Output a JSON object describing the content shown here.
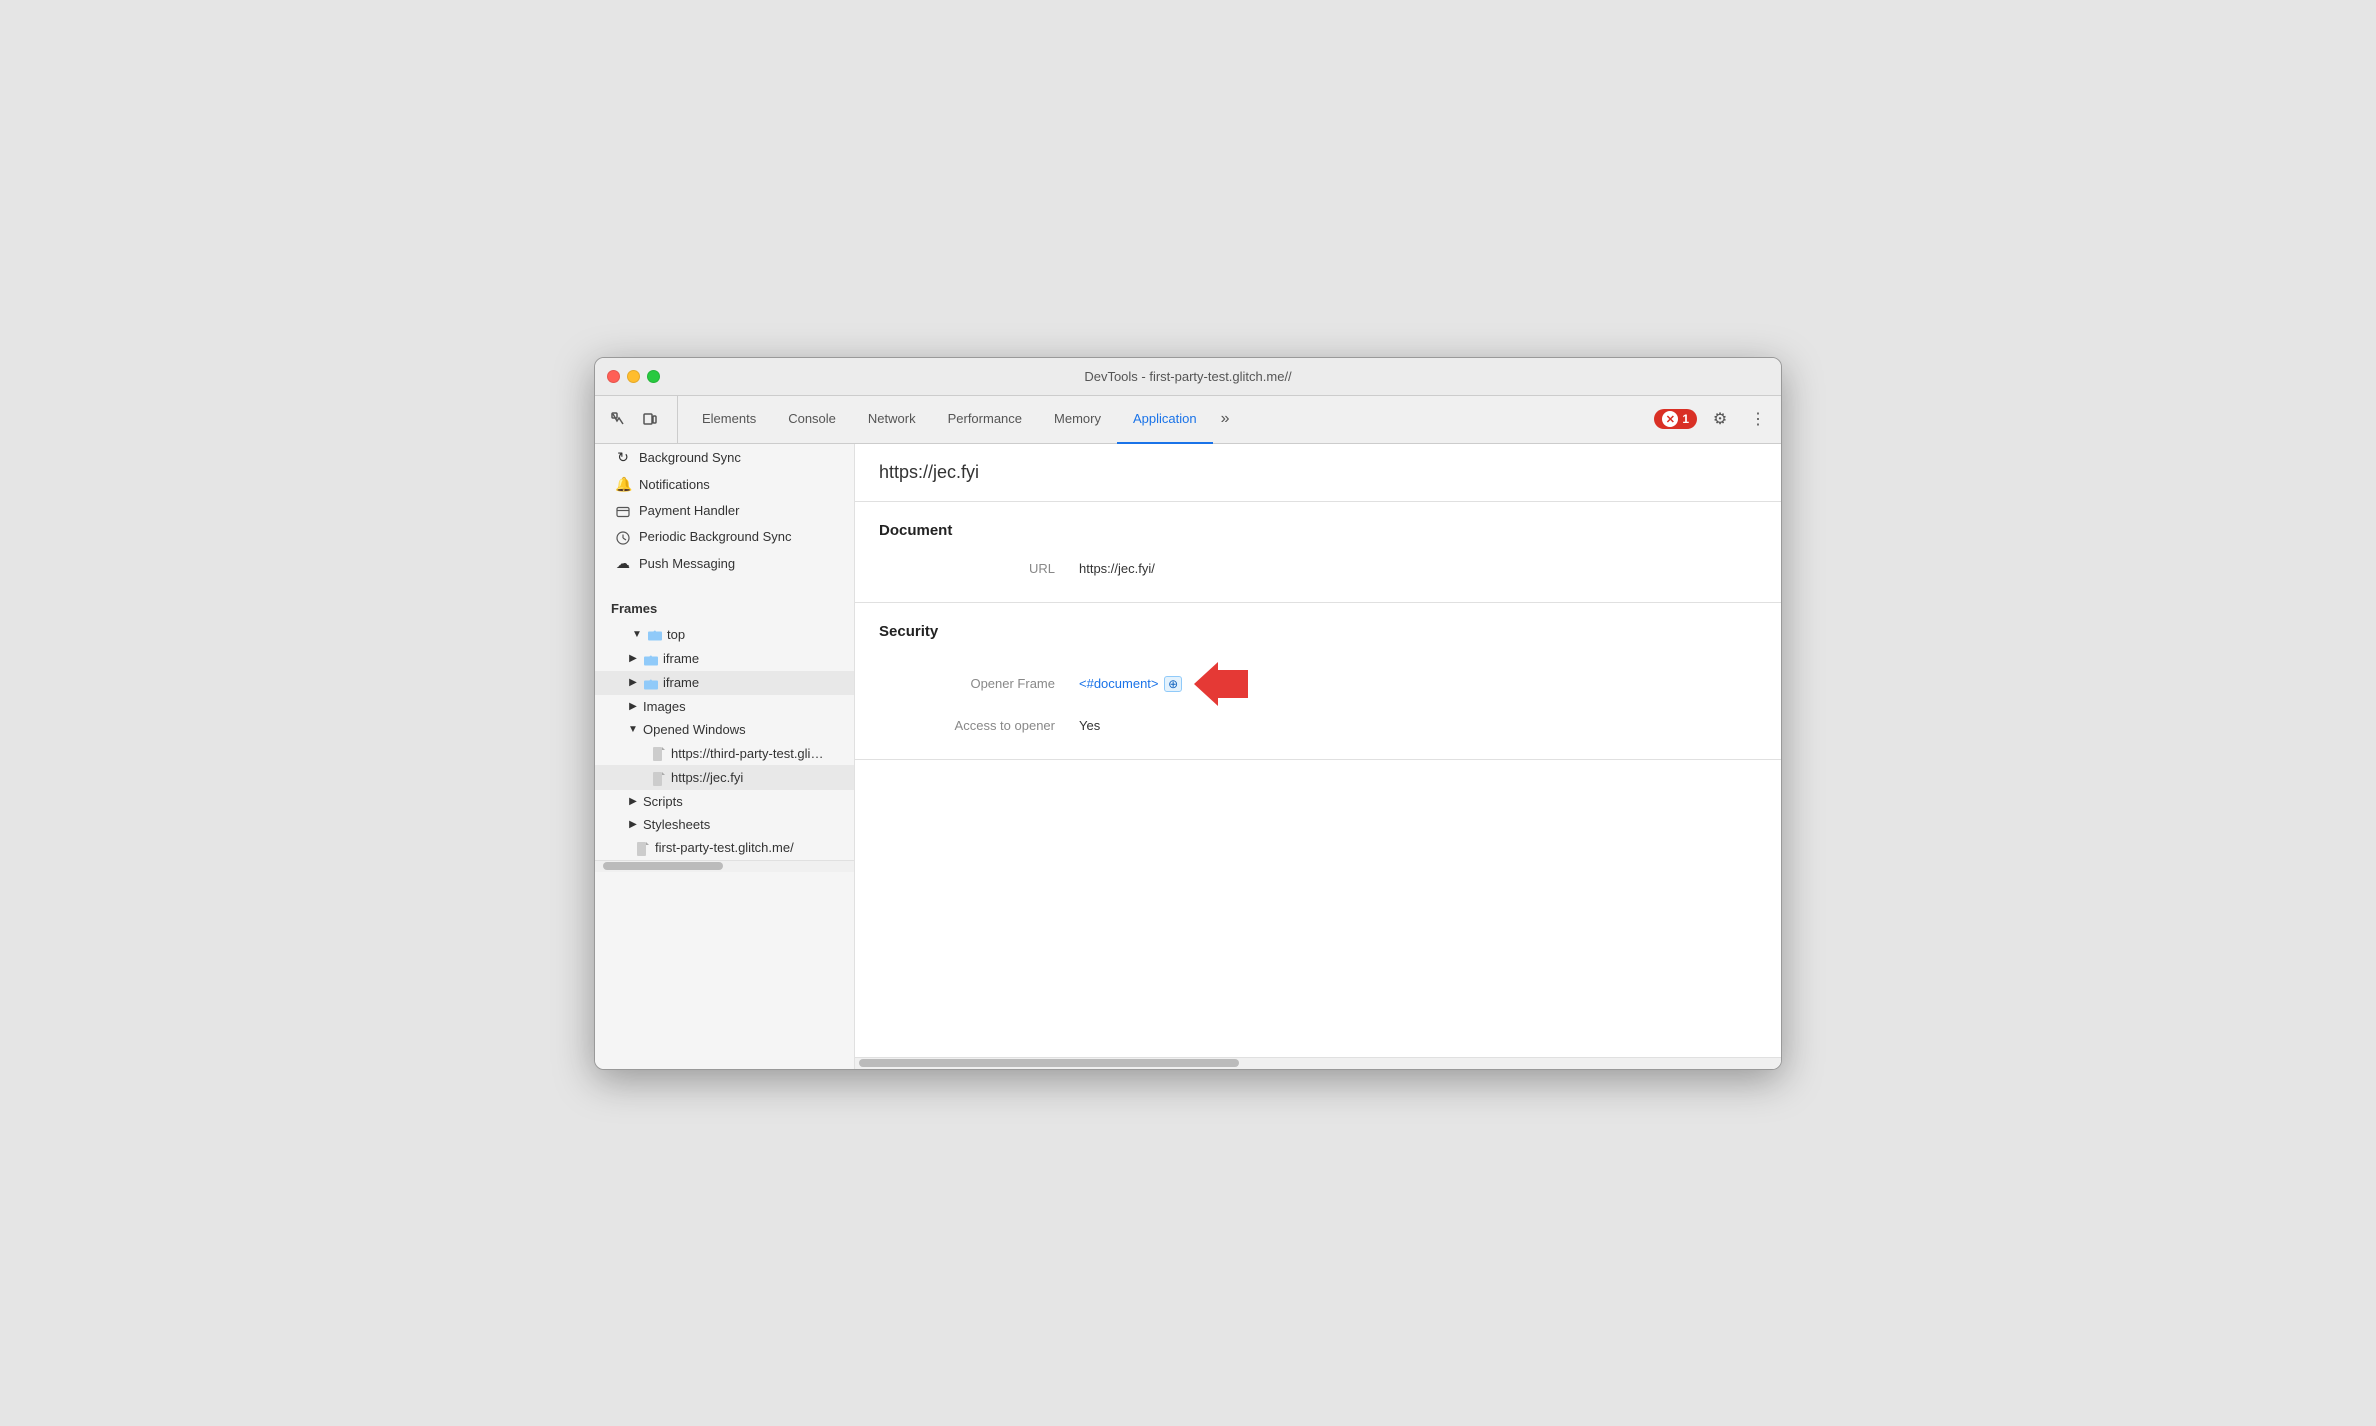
{
  "window": {
    "title": "DevTools - first-party-test.glitch.me//"
  },
  "toolbar": {
    "tabs": [
      {
        "label": "Elements",
        "active": false
      },
      {
        "label": "Console",
        "active": false
      },
      {
        "label": "Network",
        "active": false
      },
      {
        "label": "Performance",
        "active": false
      },
      {
        "label": "Memory",
        "active": false
      },
      {
        "label": "Application",
        "active": true
      }
    ],
    "more_label": "»",
    "error_count": "1",
    "settings_label": "⚙",
    "kebab_label": "⋮"
  },
  "sidebar": {
    "items_above": [
      {
        "label": "Background Sync",
        "icon": "sync",
        "indent": 0
      },
      {
        "label": "Notifications",
        "icon": "bell",
        "indent": 0
      },
      {
        "label": "Payment Handler",
        "icon": "credit-card",
        "indent": 0
      },
      {
        "label": "Periodic Background Sync",
        "icon": "clock",
        "indent": 0
      },
      {
        "label": "Push Messaging",
        "icon": "cloud",
        "indent": 0
      }
    ],
    "frames_section": "Frames",
    "tree": [
      {
        "label": "top",
        "type": "folder",
        "indent": 0,
        "expanded": true,
        "toggleable": true
      },
      {
        "label": "iframe",
        "type": "folder",
        "indent": 1,
        "expanded": false,
        "toggleable": true
      },
      {
        "label": "iframe",
        "type": "folder",
        "indent": 1,
        "expanded": false,
        "toggleable": true,
        "selected": true
      },
      {
        "label": "Images",
        "type": "folder-plain",
        "indent": 1,
        "expanded": false,
        "toggleable": true
      },
      {
        "label": "Opened Windows",
        "type": "folder-plain",
        "indent": 1,
        "expanded": true,
        "toggleable": true
      },
      {
        "label": "https://third-party-test.glitch.me/p",
        "type": "file",
        "indent": 2
      },
      {
        "label": "https://jec.fyi",
        "type": "file",
        "indent": 2,
        "selected": true
      },
      {
        "label": "Scripts",
        "type": "folder-plain",
        "indent": 1,
        "expanded": false,
        "toggleable": true
      },
      {
        "label": "Stylesheets",
        "type": "folder-plain",
        "indent": 1,
        "expanded": false,
        "toggleable": true
      },
      {
        "label": "first-party-test.glitch.me/",
        "type": "file",
        "indent": 1
      }
    ]
  },
  "content": {
    "url": "https://jec.fyi",
    "sections": [
      {
        "title": "Document",
        "rows": [
          {
            "label": "URL",
            "value": "https://jec.fyi/",
            "type": "text"
          }
        ]
      },
      {
        "title": "Security",
        "rows": [
          {
            "label": "Opener Frame",
            "value": "<#document>",
            "type": "link",
            "has_arrow": true
          },
          {
            "label": "Access to opener",
            "value": "Yes",
            "type": "text"
          }
        ]
      }
    ]
  }
}
